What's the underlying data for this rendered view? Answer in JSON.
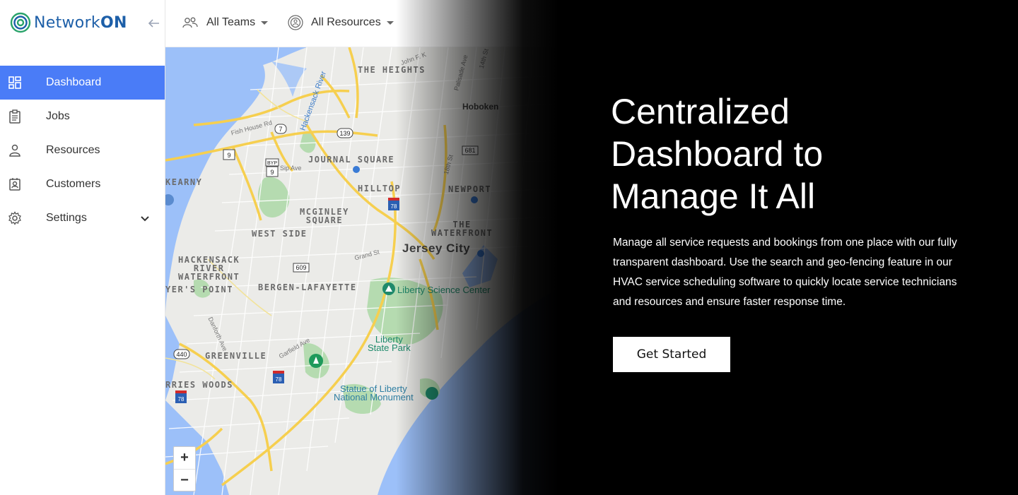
{
  "brand": {
    "name_part1": "Network",
    "name_part2": "ON"
  },
  "sidebar": {
    "items": [
      {
        "label": "Dashboard",
        "active": true
      },
      {
        "label": "Jobs",
        "active": false
      },
      {
        "label": "Resources",
        "active": false
      },
      {
        "label": "Customers",
        "active": false
      },
      {
        "label": "Settings",
        "active": false
      }
    ]
  },
  "topbar": {
    "teams_filter": "All Teams",
    "resources_filter": "All Resources"
  },
  "map": {
    "labels": [
      "THE HEIGHTS",
      "Hoboken",
      "JOURNAL SQUARE",
      "HILLTOP",
      "NEWPORT",
      "KEARNY",
      "MCGINLEY\nSQUARE",
      "WEST SIDE",
      "THE\nWATERFRONT",
      "Jersey City",
      "HACKENSACK\nRIVER\nWATERFRONT",
      "YER'S POINT",
      "BERGEN-LAFAYETTE",
      "Liberty Science Center",
      "Liberty\nState Park",
      "GREENVILLE",
      "RRIES WOODS",
      "Statue of Liberty\nNational Monument",
      "Hackensack River",
      "Fish House Rd",
      "Sip Ave",
      "Grand St",
      "Danforth Ave",
      "Garfield Ave",
      "18th St",
      "14th St",
      "Palisade Ave",
      "John F. K"
    ],
    "route_shields": [
      "7",
      "139",
      "9",
      "9",
      "BYP",
      "78",
      "609",
      "681",
      "440",
      "78",
      "78"
    ],
    "zoom_in": "+",
    "zoom_out": "−"
  },
  "hero": {
    "title_line1": "Centralized",
    "title_line2": "Dashboard to",
    "title_line3": "Manage It All",
    "description": "Manage all service requests and bookings from one place with our fully transparent dashboard. Use the search and geo-fencing feature in our HVAC service scheduling software to quickly locate service technicians and resources and ensure faster response time.",
    "cta_label": "Get Started"
  },
  "colors": {
    "accent": "#4a7cf7",
    "brand_blue": "#1d5fa8",
    "brand_green": "#2aa36b",
    "overlay": "#000000"
  }
}
